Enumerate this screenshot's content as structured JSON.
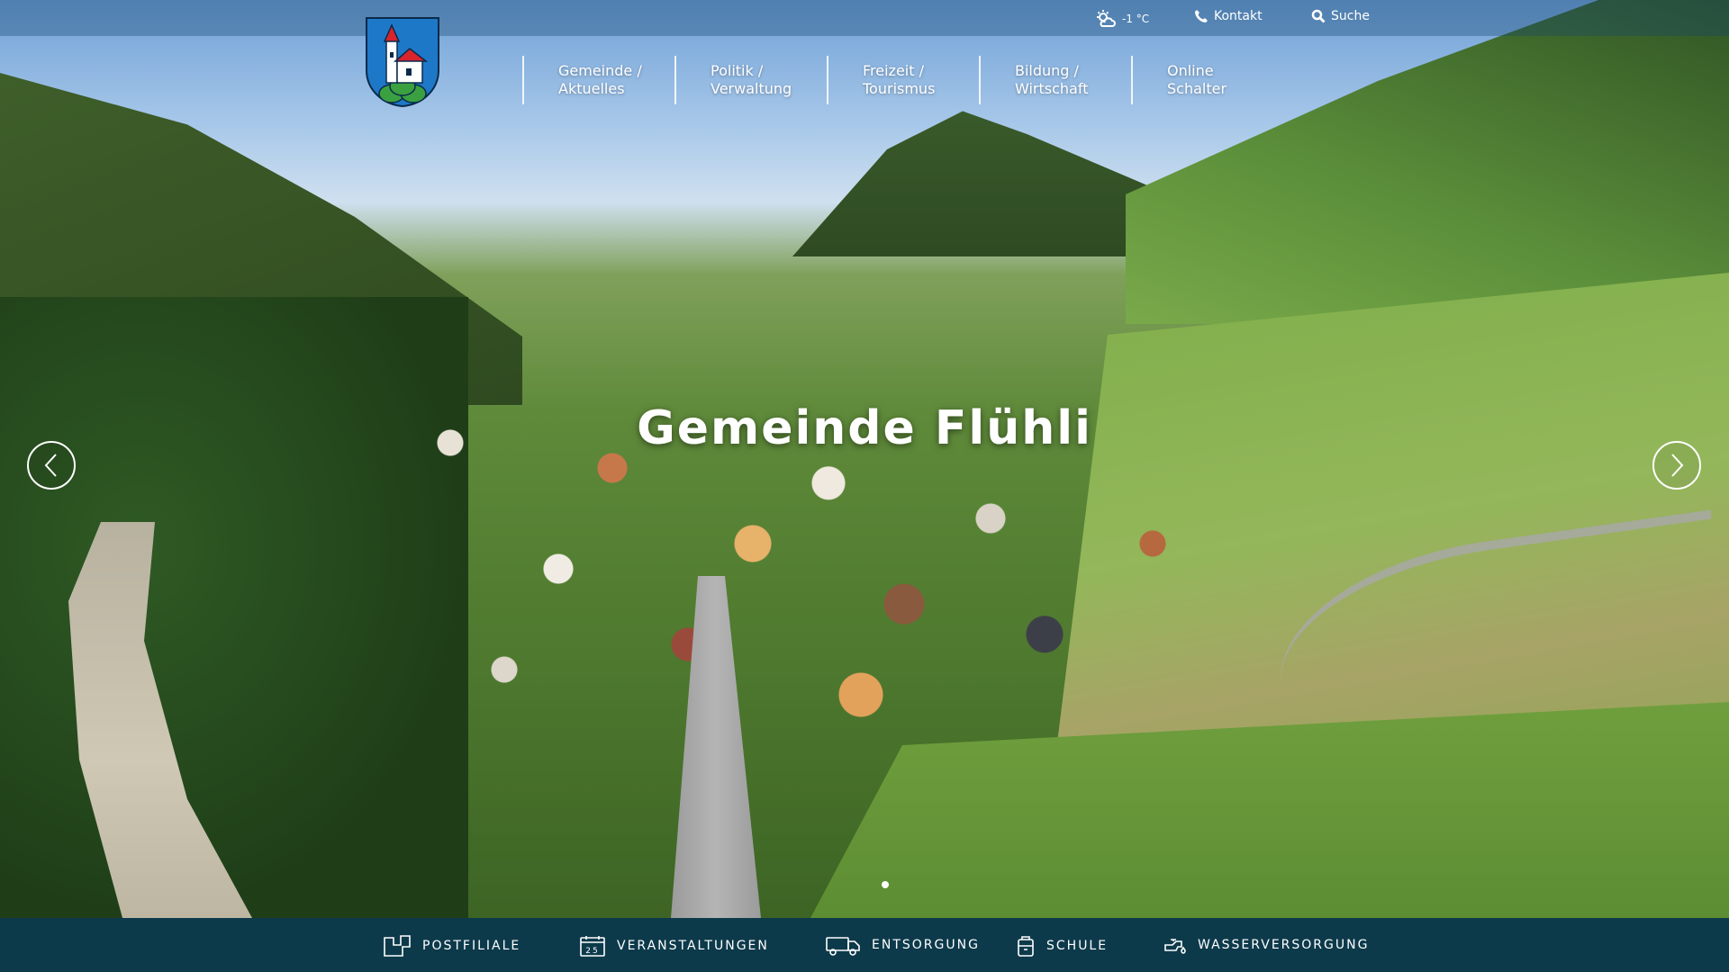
{
  "topbar": {
    "weather": "-1 °C",
    "contact": "Kontakt",
    "search": "Suche"
  },
  "nav": [
    {
      "line1": "Gemeinde /",
      "line2": "Aktuelles"
    },
    {
      "line1": "Politik /",
      "line2": "Verwaltung"
    },
    {
      "line1": "Freizeit /",
      "line2": "Tourismus"
    },
    {
      "line1": "Bildung /",
      "line2": "Wirtschaft"
    },
    {
      "line1": "Online",
      "line2": "Schalter"
    }
  ],
  "hero": {
    "title": "Gemeinde Flühli"
  },
  "quicklinks": [
    {
      "label": "POSTFILIALE",
      "icon": "post-icon"
    },
    {
      "label": "VERANSTALTUNGEN",
      "icon": "calendar-icon",
      "calendar_day": "25"
    },
    {
      "label": "ENTSORGUNG",
      "icon": "truck-icon"
    },
    {
      "label": "SCHULE",
      "icon": "school-bag-icon"
    },
    {
      "label": "WASSERVERSORGUNG",
      "icon": "water-tap-icon"
    }
  ],
  "colors": {
    "footer_bar": "#0d3a4b",
    "topbar": "rgba(20,70,110,0.35)",
    "coat_blue": "#1e78c8",
    "coat_red": "#d9232d",
    "coat_green": "#3aa040"
  }
}
